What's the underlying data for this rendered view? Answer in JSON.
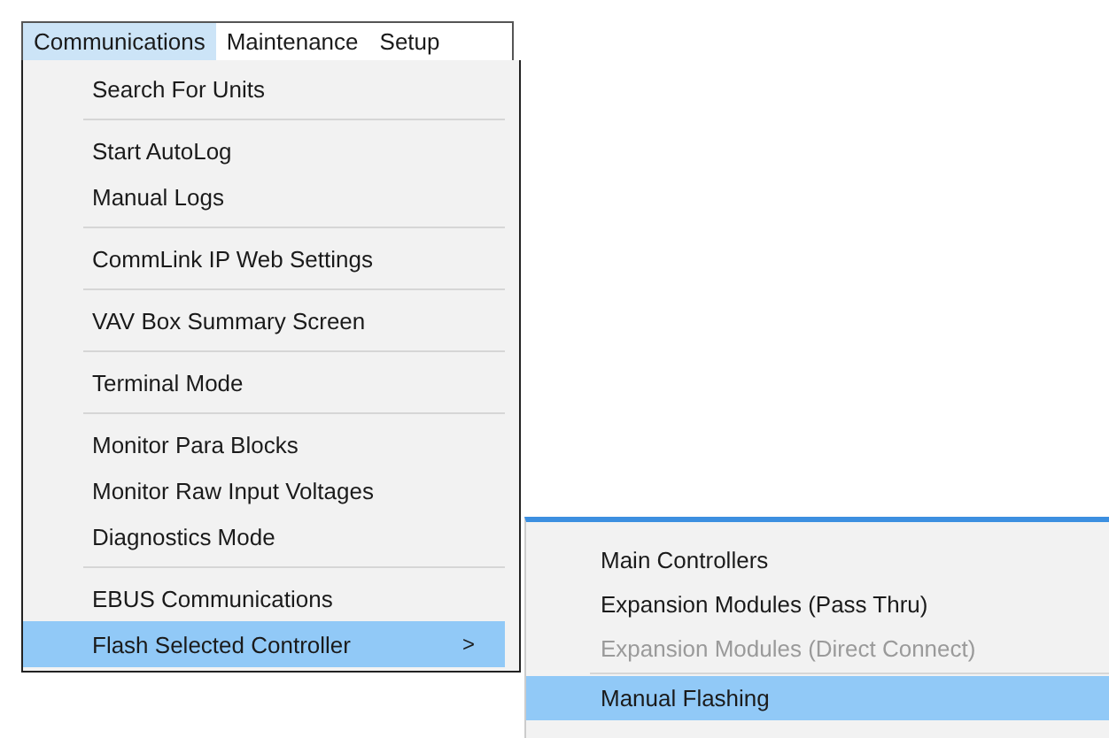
{
  "menubar": [
    {
      "label": "Communications",
      "selected": true
    },
    {
      "label": "Maintenance",
      "selected": false
    },
    {
      "label": "Setup",
      "selected": false
    }
  ],
  "menu": [
    {
      "kind": "item",
      "label": "Search For Units",
      "selected": false
    },
    {
      "kind": "separator"
    },
    {
      "kind": "item",
      "label": "Start AutoLog",
      "selected": false
    },
    {
      "kind": "item",
      "label": "Manual Logs",
      "selected": false
    },
    {
      "kind": "separator"
    },
    {
      "kind": "item",
      "label": "CommLink IP Web Settings",
      "selected": false
    },
    {
      "kind": "separator"
    },
    {
      "kind": "item",
      "label": "VAV Box Summary Screen",
      "selected": false
    },
    {
      "kind": "separator"
    },
    {
      "kind": "item",
      "label": "Terminal Mode",
      "selected": false
    },
    {
      "kind": "separator"
    },
    {
      "kind": "item",
      "label": "Monitor Para Blocks",
      "selected": false
    },
    {
      "kind": "item",
      "label": "Monitor Raw Input Voltages",
      "selected": false
    },
    {
      "kind": "item",
      "label": "Diagnostics Mode",
      "selected": false
    },
    {
      "kind": "separator"
    },
    {
      "kind": "item",
      "label": "EBUS Communications",
      "selected": false
    },
    {
      "kind": "item",
      "label": "Flash Selected Controller",
      "selected": true,
      "submenu_arrow": ">"
    }
  ],
  "submenu": [
    {
      "kind": "item",
      "label": "Main Controllers",
      "disabled": false,
      "selected": false
    },
    {
      "kind": "item",
      "label": "Expansion Modules (Pass Thru)",
      "disabled": false,
      "selected": false
    },
    {
      "kind": "item",
      "label": "Expansion Modules (Direct Connect)",
      "disabled": true,
      "selected": false
    },
    {
      "kind": "separator"
    },
    {
      "kind": "item",
      "label": "Manual Flashing",
      "disabled": false,
      "selected": true
    }
  ]
}
